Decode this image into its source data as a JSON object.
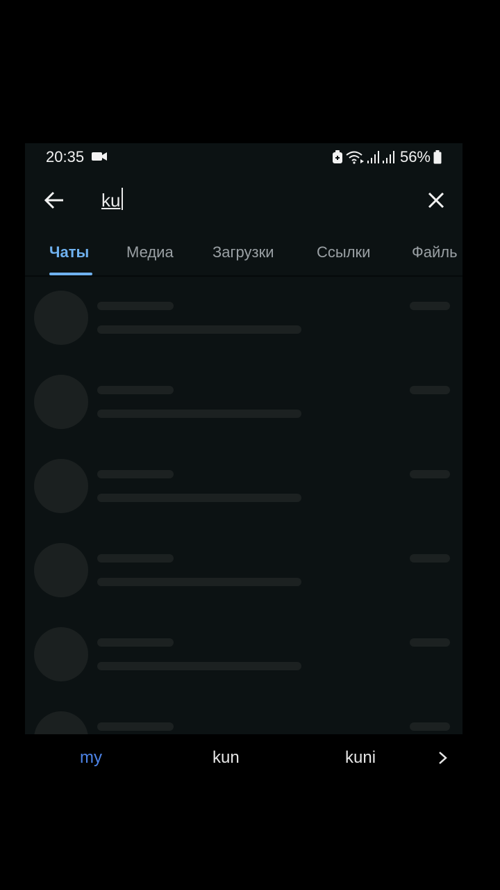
{
  "status_bar": {
    "time": "20:35",
    "battery": "56%",
    "icons": [
      "video-icon",
      "battery-saver-icon",
      "wifi-icon",
      "signal-icon",
      "signal-icon",
      "battery-icon"
    ]
  },
  "search": {
    "query": "ku",
    "back_icon": "arrow-left-icon",
    "clear_icon": "close-icon"
  },
  "tabs": [
    {
      "label": "Чаты",
      "active": true
    },
    {
      "label": "Медиа",
      "active": false
    },
    {
      "label": "Загрузки",
      "active": false
    },
    {
      "label": "Ссылки",
      "active": false
    },
    {
      "label": "Файль",
      "active": false
    }
  ],
  "results": {
    "loading": true,
    "placeholder_rows": 6
  },
  "keyboard_suggestions": {
    "items": [
      "my",
      "kun",
      "kuni"
    ],
    "highlighted": "my",
    "more_icon": "chevron-right-icon"
  },
  "colors": {
    "background": "#0c1213",
    "accent": "#6fb1ef",
    "suggestion_highlight": "#4d84e8",
    "skeleton": "#1c2121"
  }
}
